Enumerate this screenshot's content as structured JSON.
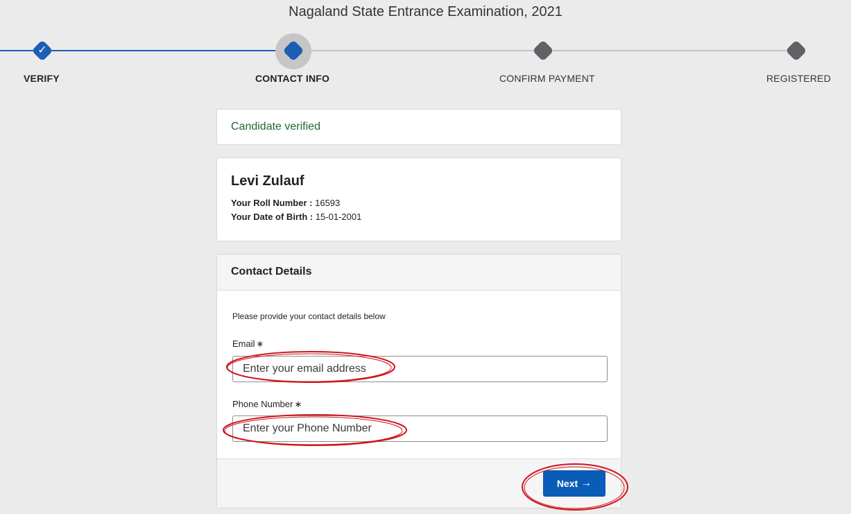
{
  "page": {
    "title": "Nagaland State Entrance Examination, 2021"
  },
  "stepper": {
    "steps": [
      {
        "label": "VERIFY",
        "state": "complete"
      },
      {
        "label": "CONTACT INFO",
        "state": "active"
      },
      {
        "label": "CONFIRM PAYMENT",
        "state": "pending"
      },
      {
        "label": "REGISTERED",
        "state": "pending"
      }
    ],
    "check_glyph": "✓"
  },
  "alert": {
    "text": "Candidate verified"
  },
  "candidate": {
    "name": "Levi Zulauf",
    "roll_label": "Your Roll Number :",
    "roll_value": "16593",
    "dob_label": "Your Date of Birth :",
    "dob_value": "15-01-2001"
  },
  "contact": {
    "header": "Contact Details",
    "instructions": "Please provide your contact details below",
    "email": {
      "label": "Email",
      "required_mark": "∗",
      "placeholder": "Enter your email address",
      "value": ""
    },
    "phone": {
      "label": "Phone Number",
      "required_mark": "∗",
      "placeholder": "Enter your Phone Number",
      "value": ""
    },
    "next_label": "Next",
    "next_icon": "→"
  },
  "colors": {
    "primary": "#0b5cb7",
    "success_text": "#1f6b2f",
    "pending_step": "#5f6266",
    "annotation": "#d0141b"
  }
}
